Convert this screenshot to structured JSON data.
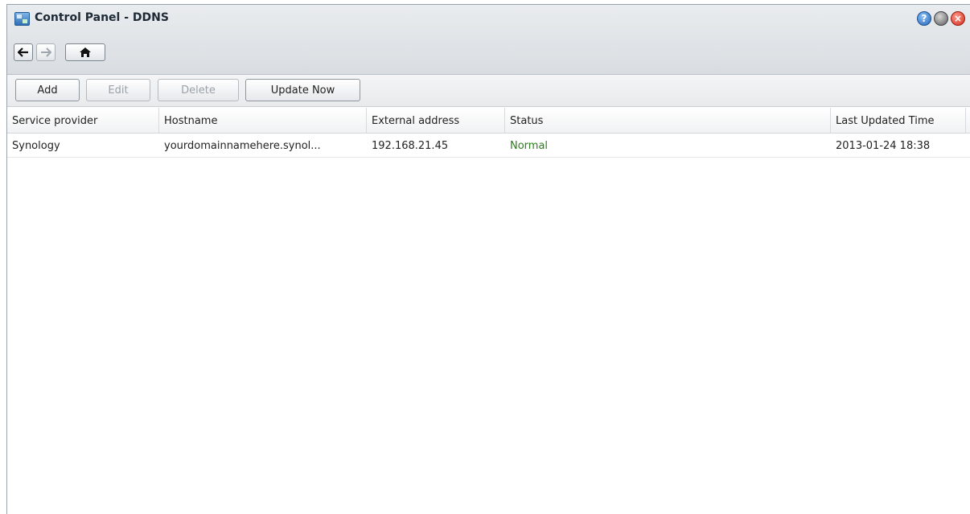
{
  "window": {
    "title": "Control Panel - DDNS",
    "controls": {
      "help_icon": "question-icon",
      "minimize_icon": "minimize-icon",
      "close_icon": "close-icon"
    }
  },
  "nav": {
    "back_glyph": "🡐",
    "forward_glyph": "→",
    "home_glyph": "🏠"
  },
  "toolbar": {
    "add_label": "Add",
    "edit_label": "Edit",
    "delete_label": "Delete",
    "update_label": "Update Now"
  },
  "table": {
    "columns": [
      "Service provider",
      "Hostname",
      "External address",
      "Status",
      "Last Updated Time"
    ],
    "rows": [
      {
        "provider": "Synology",
        "hostname": "yourdomainnamehere.synol...",
        "external_address": "192.168.21.45",
        "status": "Normal",
        "last_updated": "2013-01-24 18:38"
      }
    ]
  },
  "colors": {
    "status_normal": "#2e7d1f",
    "accent": "#2866b8"
  }
}
